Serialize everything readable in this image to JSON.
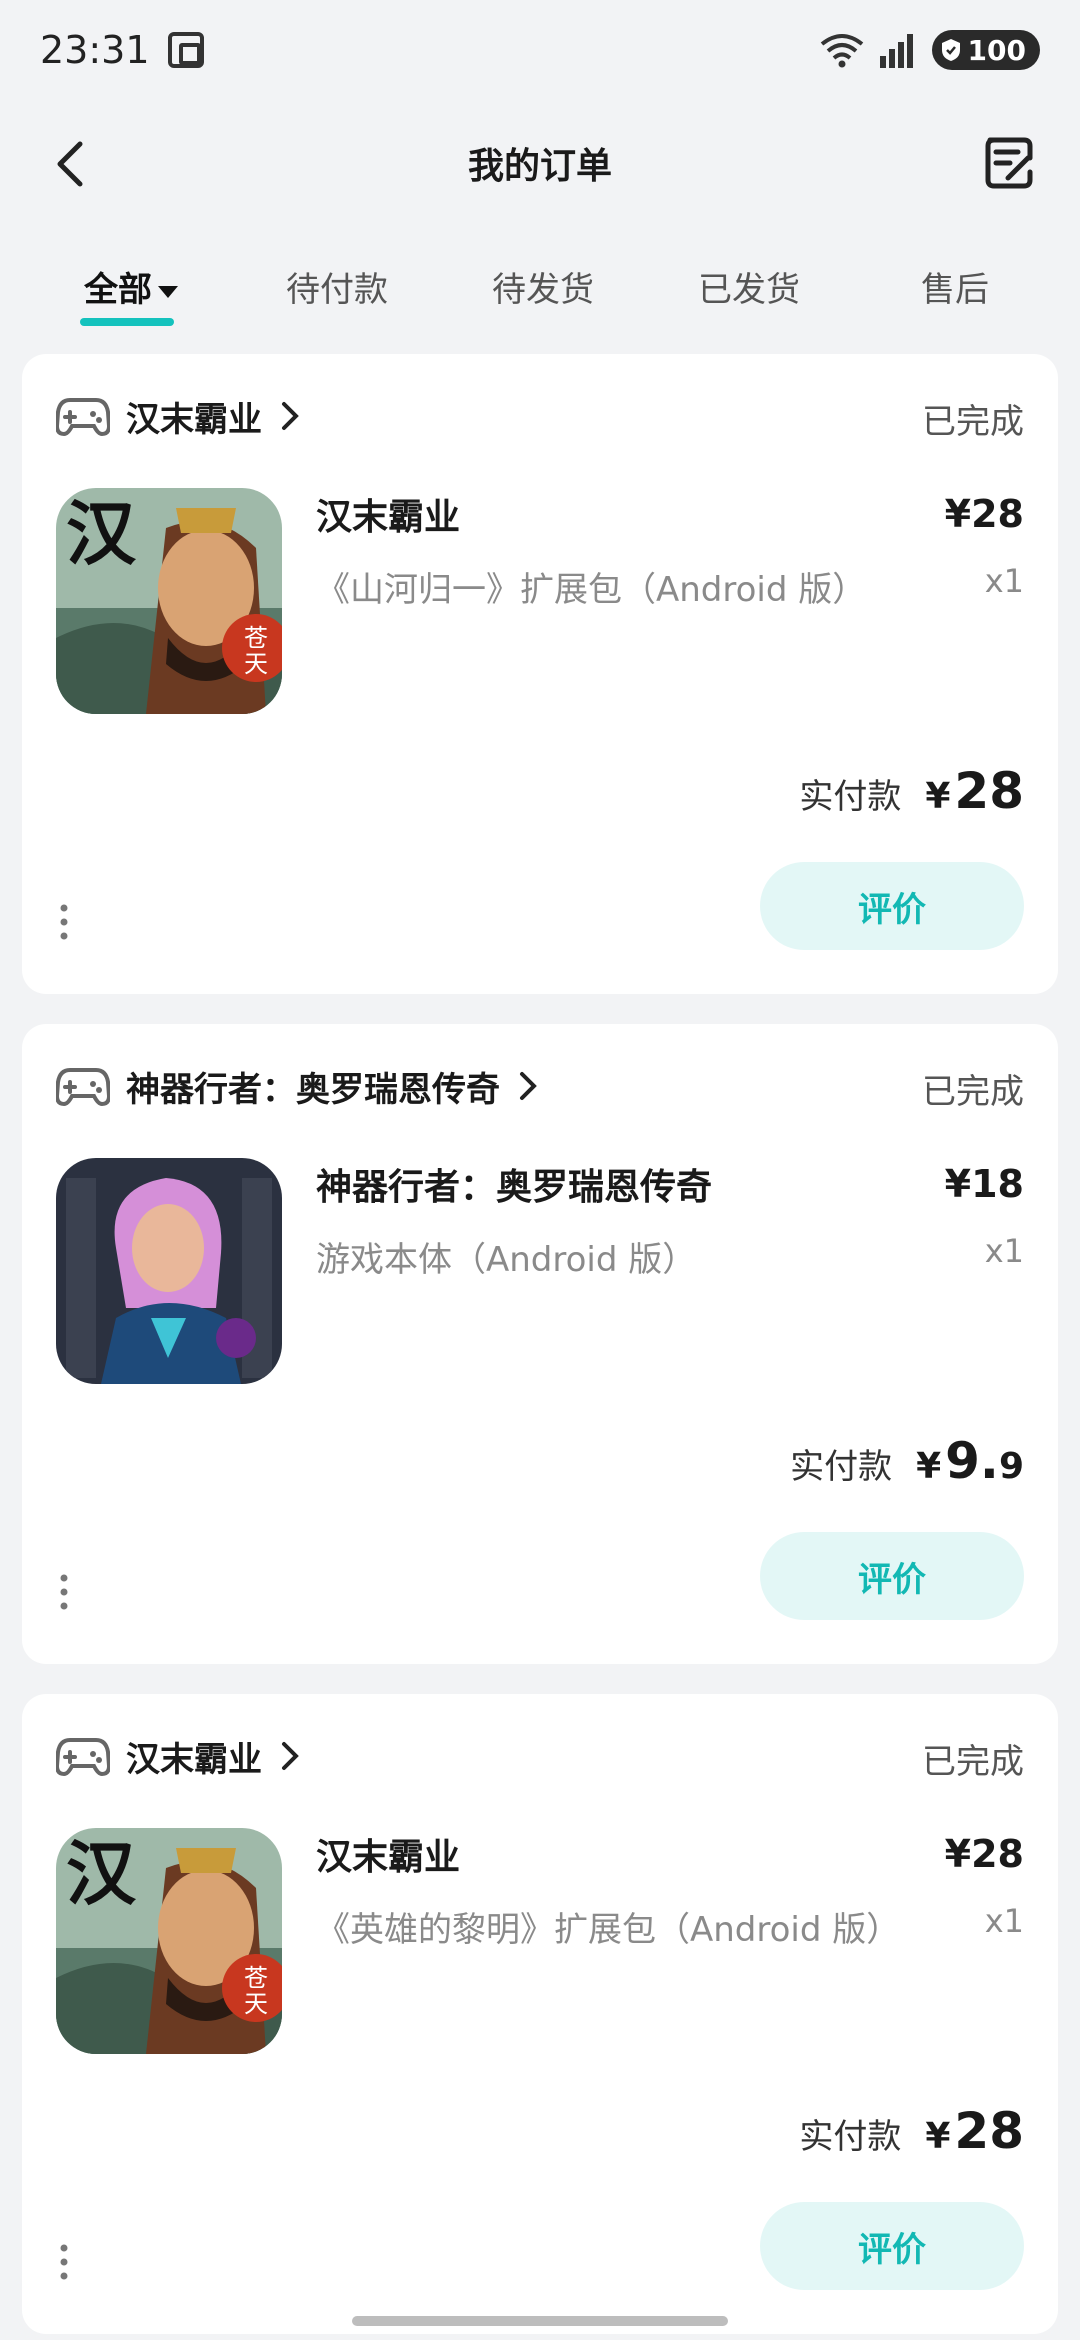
{
  "status_bar": {
    "time": "23:31",
    "battery": "100"
  },
  "header": {
    "title": "我的订单"
  },
  "tabs": [
    {
      "label": "全部",
      "active": true
    },
    {
      "label": "待付款",
      "active": false
    },
    {
      "label": "待发货",
      "active": false
    },
    {
      "label": "已发货",
      "active": false
    },
    {
      "label": "售后",
      "active": false
    }
  ],
  "orders": [
    {
      "store": "汉末霸业",
      "status": "已完成",
      "product_name": "汉末霸业",
      "product_desc": "《山河归一》扩展包（Android 版）",
      "price": "¥28",
      "qty": "x1",
      "paid_label": "实付款",
      "paid_currency": "¥",
      "paid_int": "28",
      "paid_dec": "",
      "review_label": "评价",
      "thumb": "han-mo-ba-ye"
    },
    {
      "store": "神器行者：奥罗瑞恩传奇",
      "status": "已完成",
      "product_name": "神器行者：奥罗瑞恩传奇",
      "product_desc": "游戏本体（Android 版）",
      "price": "¥18",
      "qty": "x1",
      "paid_label": "实付款",
      "paid_currency": "¥",
      "paid_int": "9.",
      "paid_dec": "9",
      "review_label": "评价",
      "thumb": "shen-qi-xing-zhe"
    },
    {
      "store": "汉末霸业",
      "status": "已完成",
      "product_name": "汉末霸业",
      "product_desc": "《英雄的黎明》扩展包（Android 版）",
      "price": "¥28",
      "qty": "x1",
      "paid_label": "实付款",
      "paid_currency": "¥",
      "paid_int": "28",
      "paid_dec": "",
      "review_label": "评价",
      "thumb": "han-mo-ba-ye"
    }
  ],
  "colors": {
    "accent": "#14c2bd",
    "review_bg": "#e3f7f6",
    "background": "#f2f3f5"
  },
  "icons": [
    "back-icon",
    "edit-order-icon",
    "gamepad-icon",
    "chevron-right-icon",
    "more-dots-icon",
    "wifi-icon",
    "signal-icon",
    "screen-record-icon"
  ]
}
